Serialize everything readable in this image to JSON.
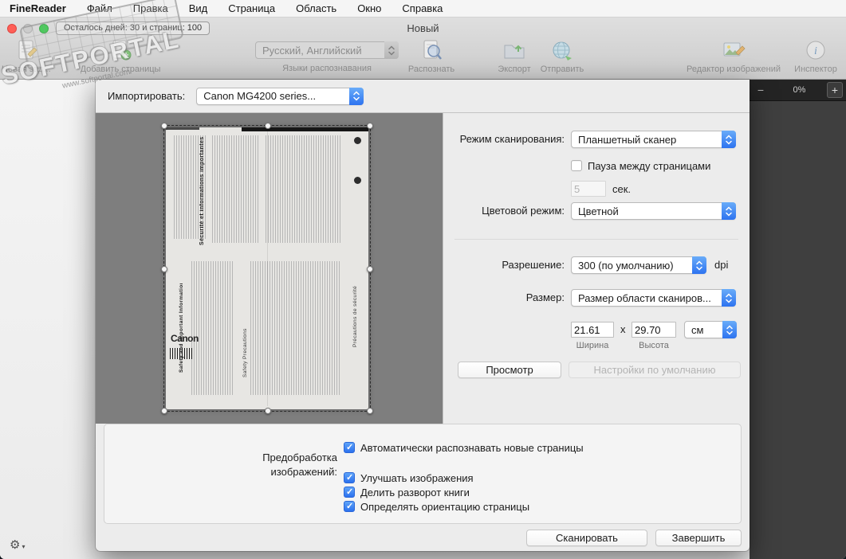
{
  "menubar": {
    "app": "FineReader",
    "items": [
      "Файл",
      "Правка",
      "Вид",
      "Страница",
      "Область",
      "Окно",
      "Справка"
    ]
  },
  "titlebar": {
    "trial": "Осталось дней: 30 и страниц: 100",
    "title": "Новый"
  },
  "toolbar": {
    "new_task": "Новая зад...",
    "add_pages": "Добавить страницы",
    "language_value": "Русский, Английский",
    "language_label": "Языки распознавания",
    "recognize": "Распознать",
    "export": "Экспорт",
    "send": "Отправить",
    "image_editor": "Редактор изображений",
    "inspector": "Инспектор"
  },
  "zoombar": {
    "minus": "−",
    "value": "0%",
    "plus": "+"
  },
  "watermark": {
    "title": "SOFTPORTAL",
    "url": "www.softportal.com"
  },
  "icons": {
    "gear": "⚙",
    "chevron_down": "▾"
  },
  "sheet": {
    "import_label": "Импортировать:",
    "import_value": "Canon MG4200 series...",
    "scan_mode_label": "Режим сканирования:",
    "scan_mode_value": "Планшетный сканер",
    "pause_label": "Пауза между страницами",
    "pause_value": "5",
    "pause_unit": "сек.",
    "color_label": "Цветовой режим:",
    "color_value": "Цветной",
    "resolution_label": "Разрешение:",
    "resolution_value": "300 (по умолчанию)",
    "resolution_unit": "dpi",
    "size_label": "Размер:",
    "size_value": "Размер области сканиров...",
    "width_value": "21.61",
    "dim_sep": "x",
    "height_value": "29.70",
    "unit_value": "см",
    "width_label": "Ширина",
    "height_label": "Высота",
    "preview_btn": "Просмотр",
    "defaults_btn": "Настройки по умолчанию",
    "preproc_label": "Предобработка изображений:",
    "checkboxes": [
      {
        "label": "Автоматически распознавать новые страницы",
        "checked": true
      },
      {
        "label": "Улучшать изображения",
        "checked": true
      },
      {
        "label": "Делить разворот книги",
        "checked": true
      },
      {
        "label": "Определять ориентацию страницы",
        "checked": true
      }
    ],
    "scan_btn": "Сканировать",
    "finish_btn": "Завершить"
  },
  "scan_preview": {
    "brand": "Canon",
    "heading_fr": "Sécurité et informations importantes",
    "heading_en": "Safety and Important Information",
    "safety_en": "Safety Precautions",
    "safety_fr": "Précautions de sécurité"
  }
}
